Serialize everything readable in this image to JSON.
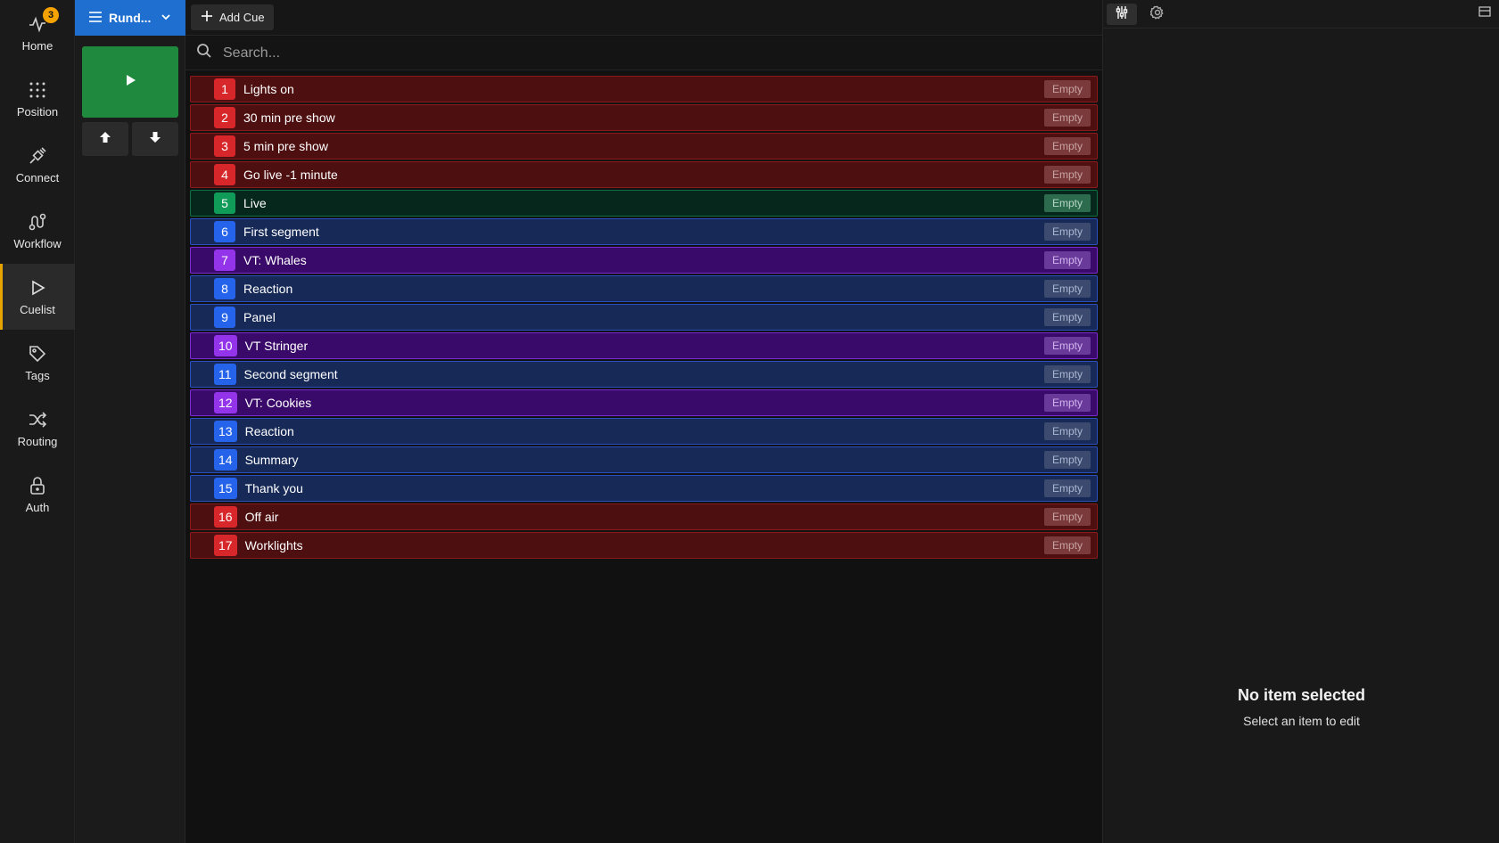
{
  "nav": {
    "home": {
      "label": "Home",
      "badge": "3"
    },
    "position": {
      "label": "Position"
    },
    "connect": {
      "label": "Connect"
    },
    "workflow": {
      "label": "Workflow"
    },
    "cuelist": {
      "label": "Cuelist"
    },
    "tags": {
      "label": "Tags"
    },
    "routing": {
      "label": "Routing"
    },
    "auth": {
      "label": "Auth"
    }
  },
  "rundown": {
    "label": "Rund..."
  },
  "toolbar": {
    "add_cue": "Add Cue"
  },
  "search": {
    "placeholder": "Search..."
  },
  "cues": [
    {
      "num": "1",
      "title": "Lights on",
      "status": "Empty",
      "color": "red"
    },
    {
      "num": "2",
      "title": "30 min pre show",
      "status": "Empty",
      "color": "red"
    },
    {
      "num": "3",
      "title": "5 min pre show",
      "status": "Empty",
      "color": "red"
    },
    {
      "num": "4",
      "title": "Go live -1 minute",
      "status": "Empty",
      "color": "red"
    },
    {
      "num": "5",
      "title": "Live",
      "status": "Empty",
      "color": "green"
    },
    {
      "num": "6",
      "title": "First segment",
      "status": "Empty",
      "color": "blue"
    },
    {
      "num": "7",
      "title": "VT: Whales",
      "status": "Empty",
      "color": "purple"
    },
    {
      "num": "8",
      "title": "Reaction",
      "status": "Empty",
      "color": "blue"
    },
    {
      "num": "9",
      "title": "Panel",
      "status": "Empty",
      "color": "blue"
    },
    {
      "num": "10",
      "title": "VT Stringer",
      "status": "Empty",
      "color": "purple"
    },
    {
      "num": "11",
      "title": "Second segment",
      "status": "Empty",
      "color": "blue"
    },
    {
      "num": "12",
      "title": "VT: Cookies",
      "status": "Empty",
      "color": "purple"
    },
    {
      "num": "13",
      "title": "Reaction",
      "status": "Empty",
      "color": "blue"
    },
    {
      "num": "14",
      "title": "Summary",
      "status": "Empty",
      "color": "blue"
    },
    {
      "num": "15",
      "title": "Thank you",
      "status": "Empty",
      "color": "blue"
    },
    {
      "num": "16",
      "title": "Off air",
      "status": "Empty",
      "color": "red"
    },
    {
      "num": "17",
      "title": "Worklights",
      "status": "Empty",
      "color": "red"
    }
  ],
  "panel": {
    "heading": "No item selected",
    "subtext": "Select an item to edit"
  },
  "colors": {
    "accent": "#1e6fd0",
    "go": "#1f8a3e",
    "badge": "#f5a300"
  }
}
